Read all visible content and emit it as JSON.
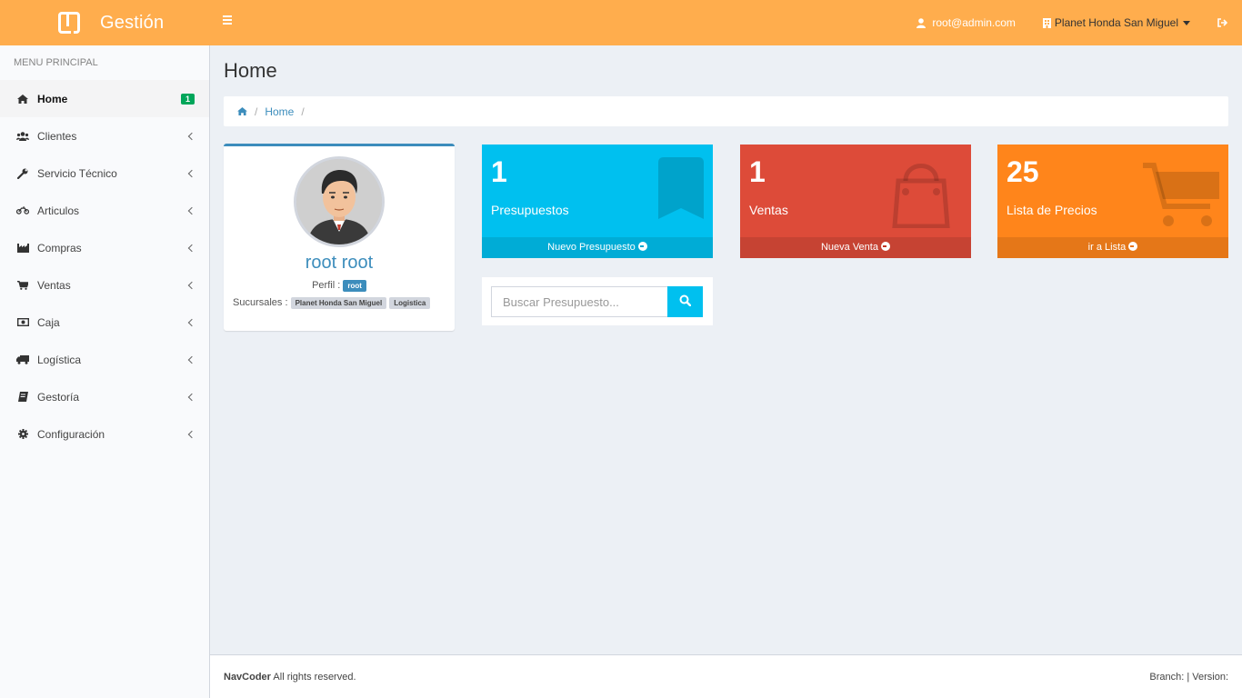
{
  "app": {
    "title": "Gestión"
  },
  "header": {
    "user_email": "root@admin.com",
    "branch": "Planet Honda San Miguel"
  },
  "sidebar": {
    "header": "MENU PRINCIPAL",
    "items": [
      {
        "label": "Home",
        "icon": "home-icon",
        "badge": "1"
      },
      {
        "label": "Clientes",
        "icon": "users-icon"
      },
      {
        "label": "Servicio Técnico",
        "icon": "wrench-icon"
      },
      {
        "label": "Articulos",
        "icon": "motorcycle-icon"
      },
      {
        "label": "Compras",
        "icon": "industry-icon"
      },
      {
        "label": "Ventas",
        "icon": "cart-icon"
      },
      {
        "label": "Caja",
        "icon": "money-icon"
      },
      {
        "label": "Logística",
        "icon": "truck-icon"
      },
      {
        "label": "Gestoría",
        "icon": "book-icon"
      },
      {
        "label": "Configuración",
        "icon": "gear-icon"
      }
    ]
  },
  "page": {
    "title": "Home",
    "breadcrumb": [
      "Home"
    ]
  },
  "profile": {
    "name": "root root",
    "perfil_label": "Perfil :",
    "perfil_value": "root",
    "sucursales_label": "Sucursales :",
    "sucursales": [
      "Planet Honda San Miguel",
      "Logistica"
    ]
  },
  "boxes": [
    {
      "number": "1",
      "label": "Presupuestos",
      "footer": "Nuevo Presupuesto",
      "color": "#00c0ef",
      "icon": "bookmark-icon"
    },
    {
      "number": "1",
      "label": "Ventas",
      "footer": "Nueva Venta",
      "color": "#dd4b39",
      "icon": "shopping-bag-icon"
    },
    {
      "number": "25",
      "label": "Lista de Precios",
      "footer": "ir a Lista",
      "color": "#ff851b",
      "icon": "shopping-cart-icon"
    }
  ],
  "search": {
    "placeholder": "Buscar Presupuesto..."
  },
  "footer": {
    "brand": "NavCoder",
    "rights": "All rights reserved.",
    "right_text": "Branch: | Version:"
  }
}
